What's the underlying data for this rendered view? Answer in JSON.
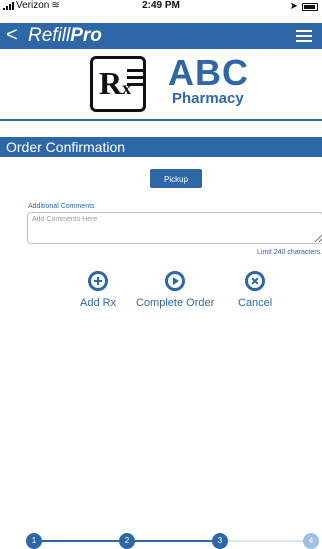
{
  "status_bar": {
    "carrier": "Verizon",
    "time": "2:49 PM"
  },
  "nav": {
    "back_label": "<",
    "title_prefix": "Refill",
    "title_bold": "Pro"
  },
  "logo": {
    "badge_text": "R",
    "badge_sub": "x",
    "name": "ABC",
    "sub": "Pharmacy"
  },
  "page": {
    "title": "Order Confirmation"
  },
  "order": {
    "pickup_label": "Pickup",
    "comments_label": "Additional Comments",
    "comments_placeholder": "Add Comments Here",
    "comments_value": "",
    "limit_text": "Limit 240 characters."
  },
  "actions": [
    {
      "label": "Add Rx",
      "icon": "add-circle-icon"
    },
    {
      "label": "Complete Order",
      "icon": "play-circle-icon"
    },
    {
      "label": "Cancel",
      "icon": "cancel-circle-icon"
    }
  ],
  "progress": {
    "steps": [
      "1",
      "2",
      "3",
      "4"
    ],
    "current_step": 3
  },
  "colors": {
    "accent": "#2e67a8",
    "inactive": "#9fbfe3"
  }
}
